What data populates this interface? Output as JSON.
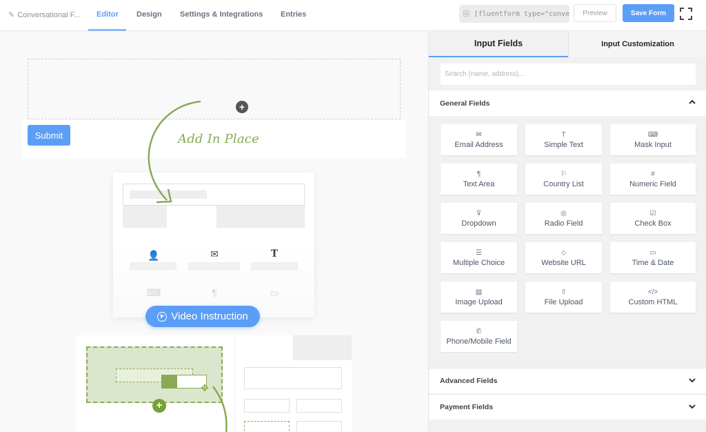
{
  "header": {
    "form_name": "Conversational F...",
    "tabs": [
      {
        "label": "Editor",
        "active": true
      },
      {
        "label": "Design",
        "active": false
      },
      {
        "label": "Settings & Integrations",
        "active": false
      },
      {
        "label": "Entries",
        "active": false
      }
    ],
    "shortcode": "[fluentform type=\"conver",
    "preview_label": "Preview",
    "save_label": "Save Form"
  },
  "canvas": {
    "submit_label": "Submit",
    "annotation": "Add In Place",
    "video_button_label": "Video Instruction"
  },
  "panel": {
    "tabs": [
      {
        "label": "Input Fields",
        "active": true
      },
      {
        "label": "Input Customization",
        "active": false
      }
    ],
    "search_placeholder": "Search (name, address)...",
    "sections": [
      {
        "label": "General Fields",
        "expanded": true
      },
      {
        "label": "Advanced Fields",
        "expanded": false
      },
      {
        "label": "Payment Fields",
        "expanded": false
      }
    ],
    "general_fields": [
      {
        "label": "Email Address",
        "icon": "envelope-icon",
        "glyph": "✉"
      },
      {
        "label": "Simple Text",
        "icon": "text-icon",
        "glyph": "T"
      },
      {
        "label": "Mask Input",
        "icon": "keyboard-icon",
        "glyph": "⌨"
      },
      {
        "label": "Text Area",
        "icon": "paragraph-icon",
        "glyph": "¶"
      },
      {
        "label": "Country List",
        "icon": "flag-icon",
        "glyph": "⚐"
      },
      {
        "label": "Numeric Field",
        "icon": "hash-icon",
        "glyph": "#"
      },
      {
        "label": "Dropdown",
        "icon": "dropdown-icon",
        "glyph": "⊽"
      },
      {
        "label": "Radio Field",
        "icon": "radio-icon",
        "glyph": "◎"
      },
      {
        "label": "Check Box",
        "icon": "checkbox-icon",
        "glyph": "☑"
      },
      {
        "label": "Multiple Choice",
        "icon": "list-icon",
        "glyph": "☰"
      },
      {
        "label": "Website URL",
        "icon": "link-icon",
        "glyph": "⬦"
      },
      {
        "label": "Time & Date",
        "icon": "calendar-icon",
        "glyph": "▭"
      },
      {
        "label": "Image Upload",
        "icon": "image-icon",
        "glyph": "▨"
      },
      {
        "label": "File Upload",
        "icon": "upload-icon",
        "glyph": "⇧"
      },
      {
        "label": "Custom HTML",
        "icon": "code-icon",
        "glyph": "</>"
      },
      {
        "label": "Phone/Mobile Field",
        "icon": "phone-icon",
        "glyph": "✆"
      }
    ]
  },
  "colors": {
    "accent": "#5b9ef7",
    "annotation_green": "#88aa55"
  }
}
